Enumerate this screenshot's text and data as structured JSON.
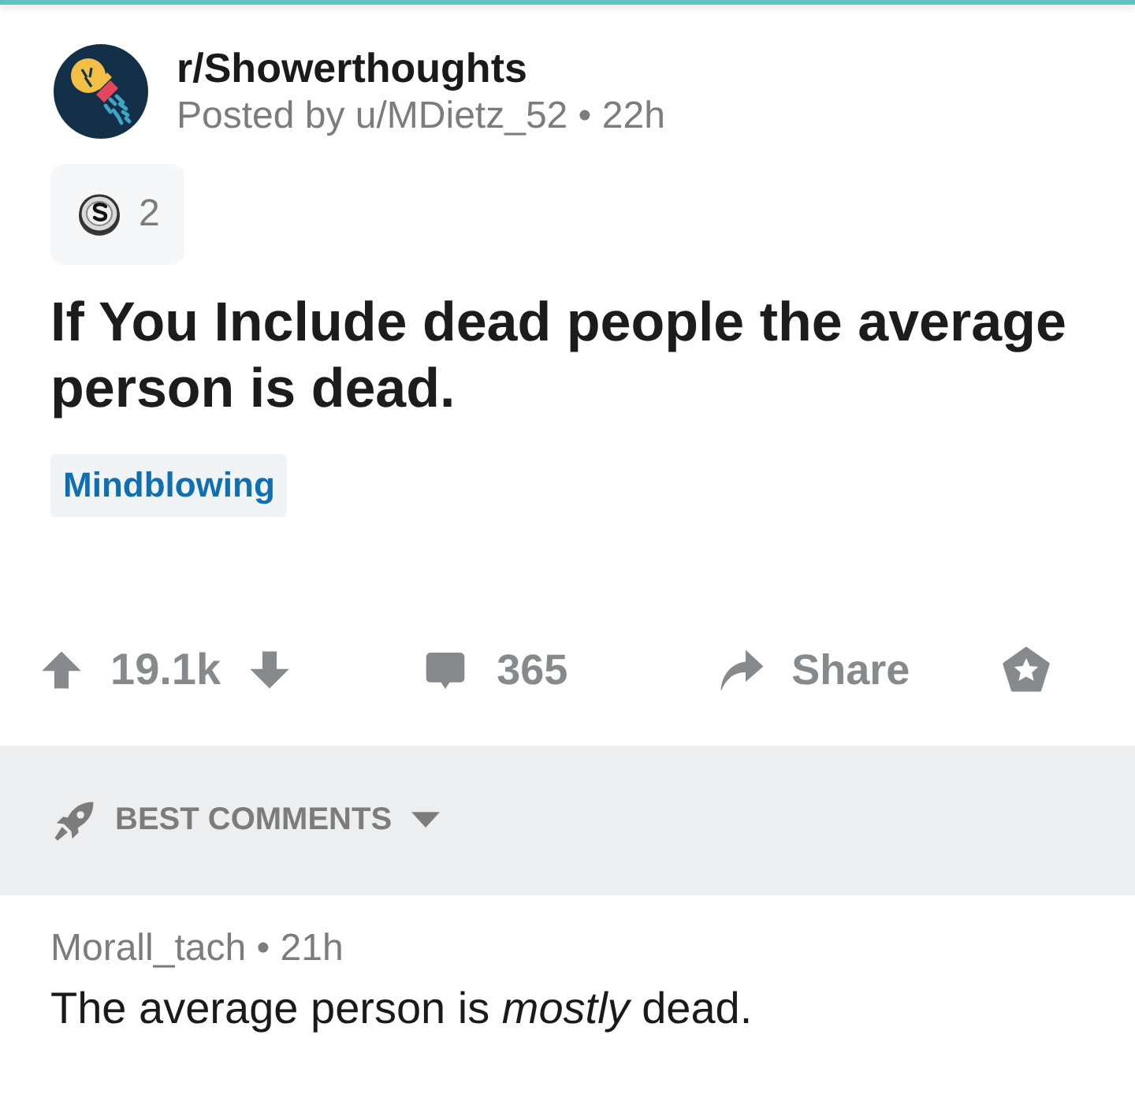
{
  "header": {
    "subreddit": "r/Showerthoughts",
    "byline": "Posted by u/MDietz_52 • 22h"
  },
  "awards": [
    {
      "count": "2"
    }
  ],
  "post": {
    "title": "If You Include dead people the average person is dead.",
    "flair": "Mindblowing"
  },
  "actions": {
    "score": "19.1k",
    "comments": "365",
    "share": "Share"
  },
  "sort": {
    "label": "BEST COMMENTS"
  },
  "comments": [
    {
      "meta": "Morall_tach • 21h",
      "body": "The average person is *mostly* dead."
    }
  ]
}
